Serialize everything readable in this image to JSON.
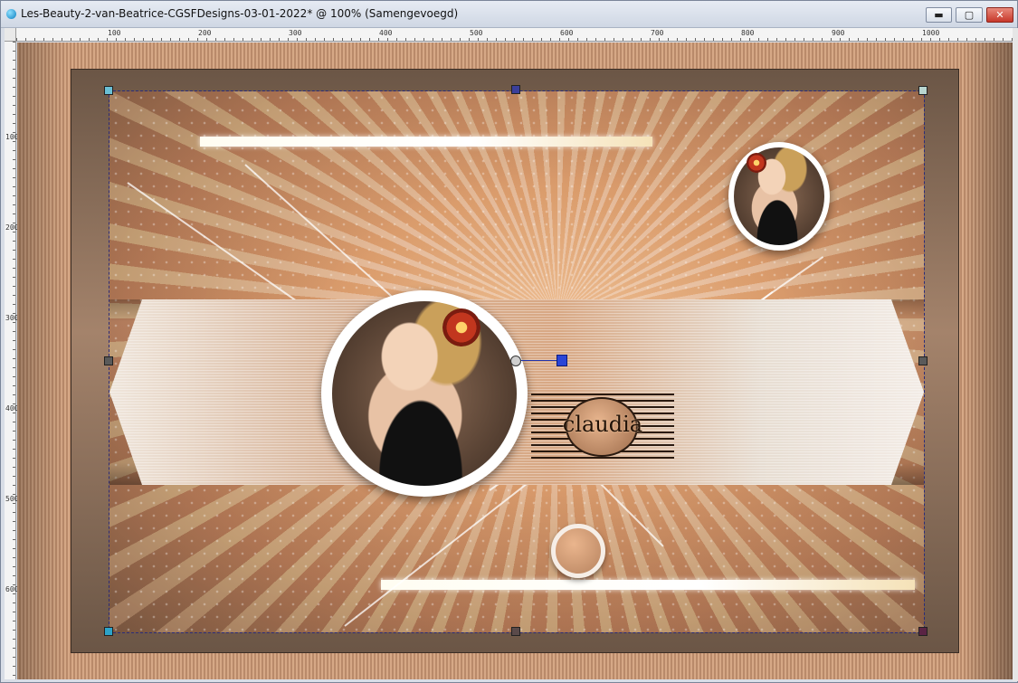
{
  "window": {
    "title": "Les-Beauty-2-van-Beatrice-CGSFDesigns-03-01-2022* @ 100% (Samengevoegd)",
    "minimize_symbol": "▬",
    "maximize_symbol": "▢",
    "close_symbol": "✕"
  },
  "ruler": {
    "horizontal_labels": [
      "100",
      "200",
      "300",
      "400",
      "500",
      "600",
      "700",
      "800",
      "900",
      "1000"
    ],
    "vertical_labels": [
      "100",
      "200",
      "300",
      "400",
      "500",
      "600"
    ]
  },
  "canvas": {
    "logo_text": "claudia"
  },
  "icons": {
    "app": "paintshop-app-icon",
    "minimize": "minimize-icon",
    "maximize": "maximize-icon",
    "close": "close-icon"
  },
  "colors": {
    "title_bar": "#d5dce8",
    "close_button": "#c7372a",
    "selection_border": "#2a2c7a",
    "pivot": "#2b45d6"
  }
}
